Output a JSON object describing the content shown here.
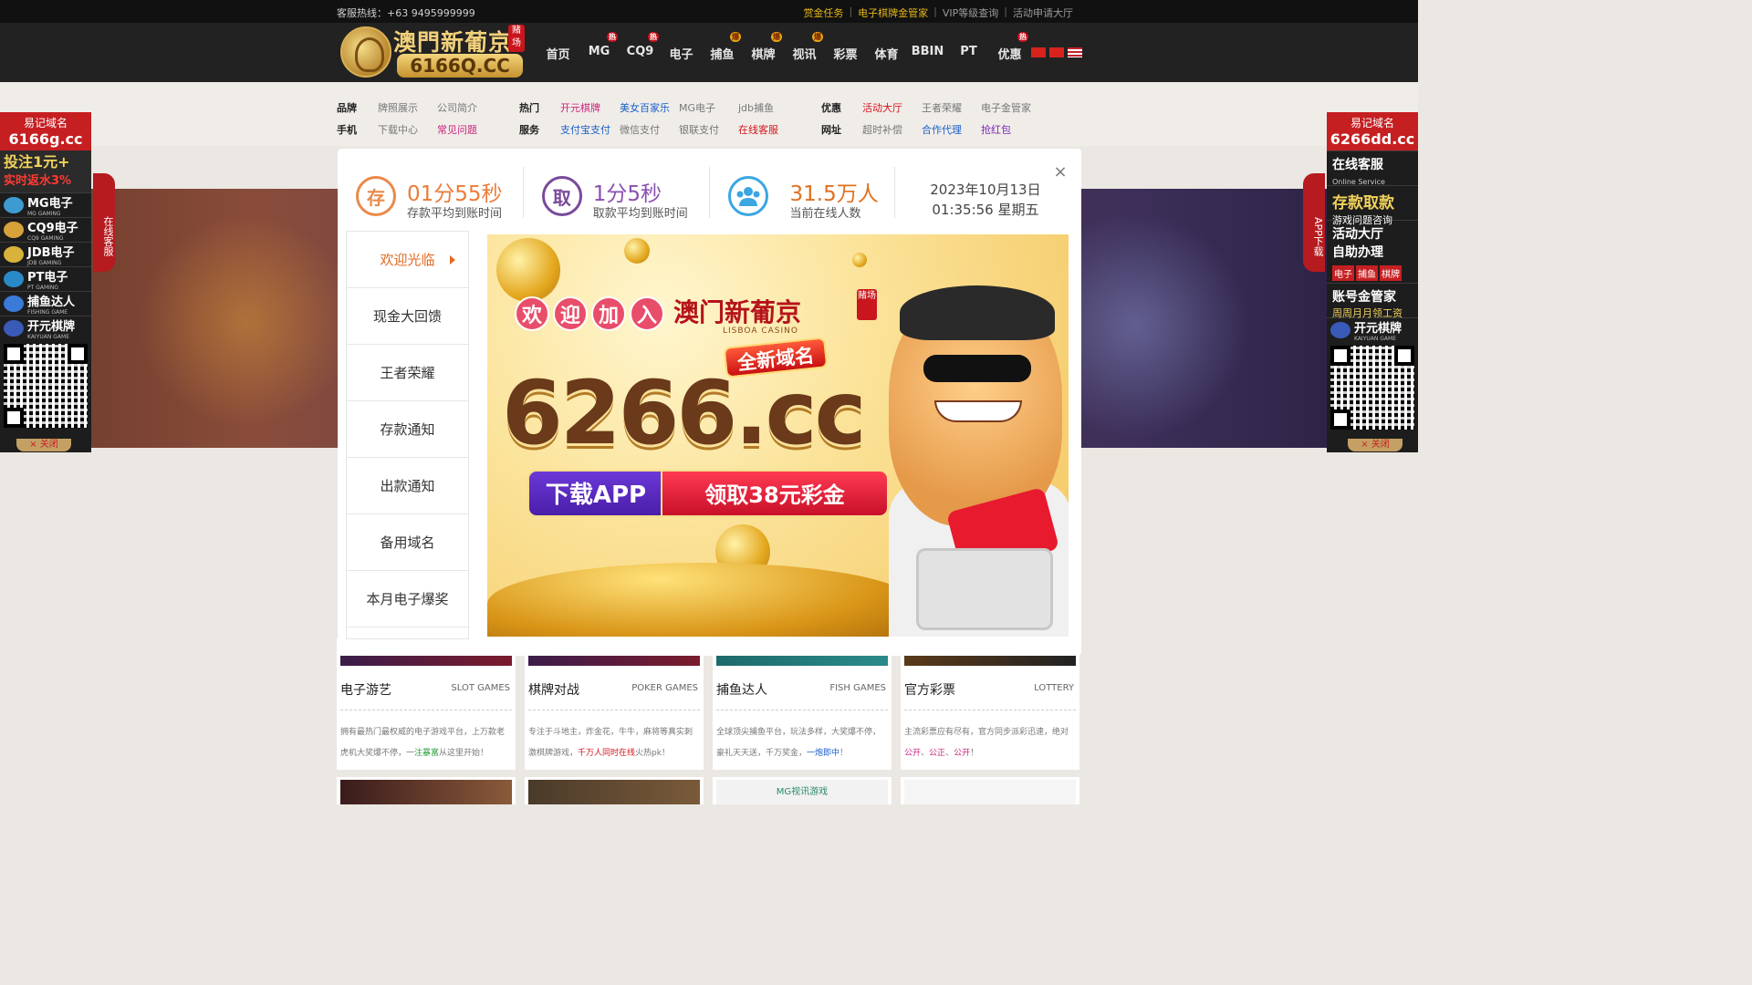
{
  "topbar": {
    "hotline": "客服热线：+63 9495999999",
    "links": [
      {
        "label": "赏金任务",
        "highlight": true
      },
      {
        "label": "电子棋牌金管家",
        "highlight": true
      },
      {
        "label": "VIP等级查询",
        "highlight": false
      },
      {
        "label": "活动申请大厅",
        "highlight": false
      }
    ]
  },
  "header": {
    "logo_name": "澳門新葡京",
    "logo_badge": "赌场",
    "logo_domain": "6166Q.CC",
    "nav": [
      {
        "label": "首页",
        "tag": ""
      },
      {
        "label": "MG",
        "tag": "热"
      },
      {
        "label": "CQ9",
        "tag": "热"
      },
      {
        "label": "电子",
        "tag": ""
      },
      {
        "label": "捕鱼",
        "tag": "爆"
      },
      {
        "label": "棋牌",
        "tag": "爆"
      },
      {
        "label": "视讯",
        "tag": "爆"
      },
      {
        "label": "彩票",
        "tag": ""
      },
      {
        "label": "体育",
        "tag": ""
      },
      {
        "label": "BBIN",
        "tag": ""
      },
      {
        "label": "PT",
        "tag": ""
      },
      {
        "label": "优惠",
        "tag": "热"
      }
    ],
    "flags": [
      "cn-flag",
      "hk-flag",
      "us-flag"
    ]
  },
  "quick": {
    "brand": {
      "label": "品牌",
      "items": [
        {
          "t": "牌照展示",
          "c": "qgrey"
        },
        {
          "t": "公司简介",
          "c": "qgrey"
        }
      ]
    },
    "mobile": {
      "label": "手机",
      "items": [
        {
          "t": "下载中心",
          "c": "qgrey"
        },
        {
          "t": "常见问题",
          "c": "qpink"
        }
      ]
    },
    "hot": {
      "label": "热门",
      "items": [
        {
          "t": "开元棋牌",
          "c": "qpink"
        },
        {
          "t": "美女百家乐",
          "c": "qblue"
        },
        {
          "t": "MG电子",
          "c": "qgrey"
        },
        {
          "t": "jdb捕鱼",
          "c": "qgrey"
        }
      ]
    },
    "service": {
      "label": "服务",
      "items": [
        {
          "t": "支付宝支付",
          "c": "qblue"
        },
        {
          "t": "微信支付",
          "c": "qgrey"
        },
        {
          "t": "银联支付",
          "c": "qgrey"
        },
        {
          "t": "在线客服",
          "c": "qred"
        }
      ]
    },
    "promo": {
      "label": "优惠",
      "items": [
        {
          "t": "活动大厅",
          "c": "qred"
        },
        {
          "t": "王者荣耀",
          "c": "qgrey"
        },
        {
          "t": "电子金管家",
          "c": "qgrey"
        }
      ]
    },
    "site": {
      "label": "网址",
      "items": [
        {
          "t": "超时补偿",
          "c": "qgrey"
        },
        {
          "t": "合作代理",
          "c": "qblue"
        },
        {
          "t": "抢红包",
          "c": "qpurple"
        }
      ]
    }
  },
  "side_left": {
    "head_label": "易记域名",
    "head_domain": "6166g.cc",
    "promo_line1": "投注1元+",
    "promo_line2": "实时返水3%",
    "items": [
      {
        "label": "MG电子",
        "sub": "MG GAMING"
      },
      {
        "label": "CQ9电子",
        "sub": "CQ9 GAMING"
      },
      {
        "label": "JDB电子",
        "sub": "JDB GAMING"
      },
      {
        "label": "PT电子",
        "sub": "PT GAMING"
      },
      {
        "label": "捕鱼达人",
        "sub": "FISHING GAME"
      },
      {
        "label": "开元棋牌",
        "sub": "KAIYUAN GAME"
      }
    ],
    "close": "× 关闭",
    "tab": "在线客服"
  },
  "side_right": {
    "head_label": "易记域名",
    "head_domain": "6266dd.cc",
    "svc1": "在线客服",
    "svc1_sub": "Online Service",
    "svc2": "存款取款",
    "svc2_sub": "游戏问题咨询",
    "svc3": "活动大厅",
    "svc3_sub": "自助办理",
    "tags": [
      "电子",
      "捕鱼",
      "棋牌"
    ],
    "svc4": "账号金管家",
    "svc4_sub": "周周月月领工资",
    "kaiyuan": "开元棋牌",
    "kaiyuan_sub": "KAIYUAN GAME",
    "close": "× 关闭",
    "tab": "APP下载"
  },
  "modal": {
    "close": "×",
    "stats": {
      "deposit": {
        "icon": "存",
        "value": "01分55秒",
        "label": "存款平均到账时间"
      },
      "withdraw": {
        "icon": "取",
        "value": "1分5秒",
        "label": "取款平均到账时间"
      },
      "online": {
        "value": "31.5万人",
        "label": "当前在线人数"
      },
      "date_line1": "2023年10月13日",
      "date_line2": "01:35:56 星期五"
    },
    "tabs": [
      "欢迎光临",
      "现金大回馈",
      "王者荣耀",
      "存款通知",
      "出款通知",
      "备用域名",
      "本月电子爆奖"
    ],
    "promo": {
      "welcome": [
        "欢",
        "迎",
        "加",
        "入"
      ],
      "casino": "澳门新葡京",
      "casino_badge": "赌场",
      "casino_sub": "LISBOA CASINO",
      "new_domain": "全新域名",
      "big_domain": "6266.cc",
      "download": "下载APP",
      "bonus": "领取38元彩金"
    }
  },
  "cards": [
    {
      "title": "电子游艺",
      "en": "SLOT GAMES",
      "desc_parts": [
        {
          "t": "拥有最热门最权威的电子游戏平台，上万款老虎机大奖爆不停，一",
          "c": ""
        },
        {
          "t": "注暴富",
          "c": "g"
        },
        {
          "t": "从这里开始！",
          "c": ""
        }
      ]
    },
    {
      "title": "棋牌对战",
      "en": "POKER GAMES",
      "desc_parts": [
        {
          "t": "专注于斗地主，炸金花，牛牛，麻将等真实刺激棋牌游戏，",
          "c": ""
        },
        {
          "t": "千万人同时在线",
          "c": "r"
        },
        {
          "t": "火热pk！",
          "c": ""
        }
      ]
    },
    {
      "title": "捕鱼达人",
      "en": "FISH GAMES",
      "desc_parts": [
        {
          "t": "全球顶尖捕鱼平台，玩法多样，大奖爆不停，豪礼天天送，千万奖金，",
          "c": ""
        },
        {
          "t": "一炮即中",
          "c": "b"
        },
        {
          "t": "！",
          "c": ""
        }
      ]
    },
    {
      "title": "官方彩票",
      "en": "LOTTERY",
      "desc_parts": [
        {
          "t": "主流彩票应有尽有，官方同步派彩迅速，绝对",
          "c": ""
        },
        {
          "t": "公开",
          "c": "m"
        },
        {
          "t": "、",
          "c": ""
        },
        {
          "t": "公正",
          "c": "m"
        },
        {
          "t": "、",
          "c": ""
        },
        {
          "t": "公开",
          "c": "m"
        },
        {
          "t": "！",
          "c": ""
        }
      ]
    }
  ],
  "cards_bottom_label": "MG视讯游戏"
}
